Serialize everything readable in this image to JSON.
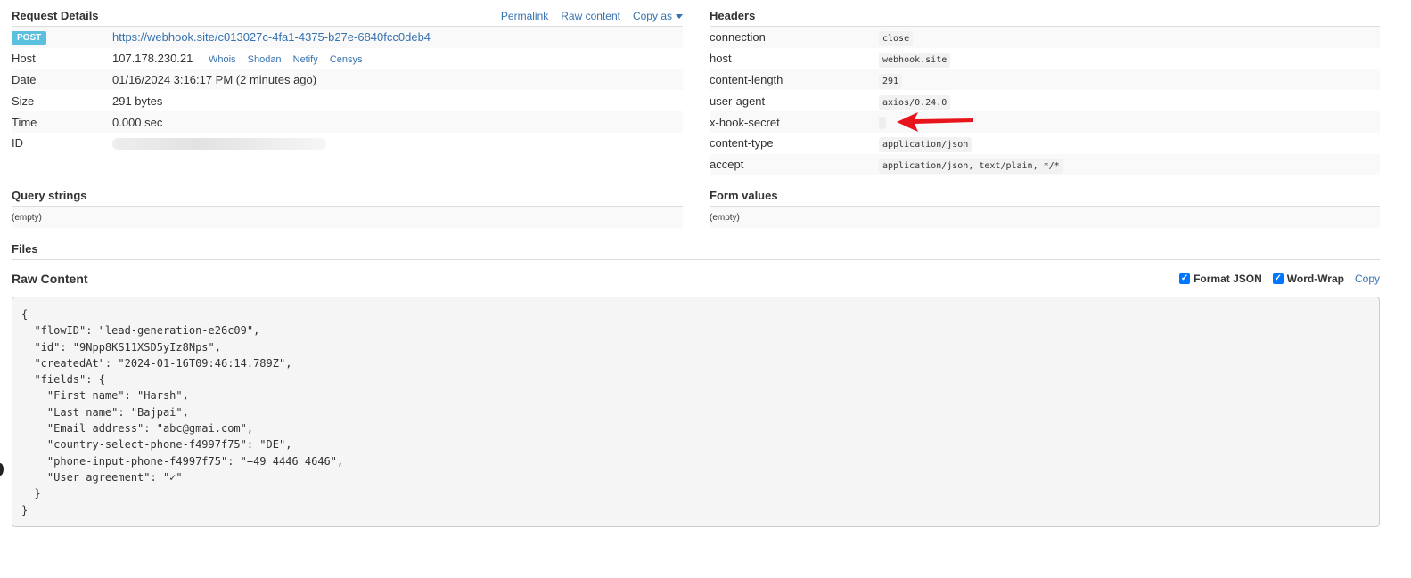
{
  "request_details": {
    "title": "Request Details",
    "links": {
      "permalink": "Permalink",
      "raw_content": "Raw content",
      "copy_as": "Copy as"
    },
    "method": "POST",
    "url": "https://webhook.site/c013027c-4fa1-4375-b27e-6840fcc0deb4",
    "rows": {
      "host_label": "Host",
      "host_value": "107.178.230.21",
      "host_links": [
        "Whois",
        "Shodan",
        "Netify",
        "Censys"
      ],
      "date_label": "Date",
      "date_value": "01/16/2024 3:16:17 PM (2 minutes ago)",
      "size_label": "Size",
      "size_value": "291 bytes",
      "time_label": "Time",
      "time_value": "0.000 sec",
      "id_label": "ID"
    }
  },
  "headers": {
    "title": "Headers",
    "items": [
      {
        "name": "connection",
        "value": "close"
      },
      {
        "name": "host",
        "value": "webhook.site"
      },
      {
        "name": "content-length",
        "value": "291"
      },
      {
        "name": "user-agent",
        "value": "axios/0.24.0"
      },
      {
        "name": "x-hook-secret",
        "value": ""
      },
      {
        "name": "content-type",
        "value": "application/json"
      },
      {
        "name": "accept",
        "value": "application/json, text/plain, */*"
      }
    ],
    "highlight_color": "#e8141b"
  },
  "query_strings": {
    "title": "Query strings",
    "value": "(empty)"
  },
  "form_values": {
    "title": "Form values",
    "value": "(empty)"
  },
  "files": {
    "title": "Files"
  },
  "raw_content": {
    "title": "Raw Content",
    "format_json_label": "Format JSON",
    "format_json_checked": true,
    "word_wrap_label": "Word-Wrap",
    "word_wrap_checked": true,
    "copy_label": "Copy",
    "lines": [
      "{",
      "  \"flowID\": \"lead-generation-e26c09\",",
      "  \"id\": \"9Npp8KS11XSD5yIz8Nps\",",
      "  \"createdAt\": \"2024-01-16T09:46:14.789Z\",",
      "  \"fields\": {",
      "    \"First name\": \"Harsh\",",
      "    \"Last name\": \"Bajpai\",",
      "    \"Email address\": \"abc@gmai.com\",",
      "    \"country-select-phone-f4997f75\": \"DE\",",
      "    \"phone-input-phone-f4997f75\": \"+49 4446 4646\",",
      "    \"User agreement\": \"✓\"",
      "  }",
      "}"
    ]
  }
}
